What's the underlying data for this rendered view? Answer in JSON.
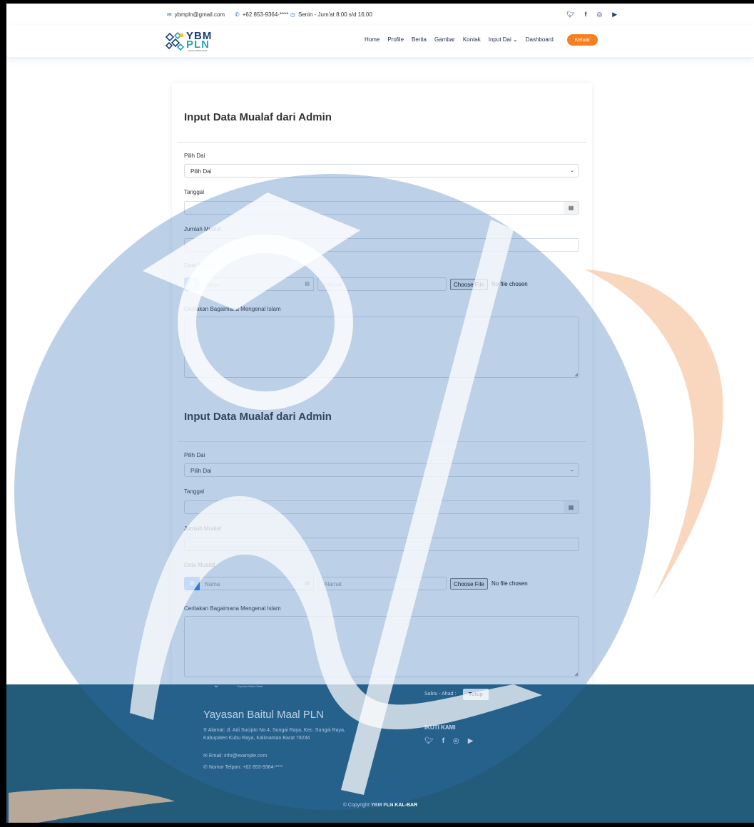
{
  "topbar": {
    "email": "ybmpln@gmail.com",
    "phone": "+62 853-9364-****",
    "hours": "Senin - Jum'at 8:00 s/d 16:00",
    "social_icons": [
      "twitter-icon",
      "facebook-icon",
      "instagram-icon",
      "youtube-icon"
    ]
  },
  "header": {
    "logo_line1": "YBM",
    "logo_line2": "PLN",
    "logo_sub": "Yayasan Baitul Maal",
    "nav": [
      "Home",
      "Profile",
      "Berita",
      "Gambar",
      "Kontak",
      "Input Dai",
      "Dashboard"
    ],
    "dropdown_chevron": "⌄",
    "logout": "Keluar",
    "accent": "#f5801f"
  },
  "forms": [
    {
      "title": "Input Data Mualaf dari Admin",
      "dai_label": "Pilih Dai",
      "dai_value": "Pilih Dai",
      "tanggal_label": "Tanggal",
      "jumlah_label": "Jumlah Mualaf",
      "data_label": "Data Mualaf",
      "nama_placeholder": "Nama",
      "alamat_placeholder": "Alamat",
      "file_button": "Choose File",
      "file_status": "No file chosen",
      "cerita_label": "Ceritakan Bagaimana Mengenal Islam"
    },
    {
      "title": "Input Data Mualaf dari Admin",
      "dai_label": "Pilih Dai",
      "dai_value": "Pilih Dai",
      "tanggal_label": "Tanggal",
      "jumlah_label": "Jumlah Mualaf",
      "data_label": "Data Mualaf",
      "nama_placeholder": "Nama",
      "alamat_placeholder": "Alamat",
      "file_button": "Choose File",
      "file_status": "No file chosen",
      "cerita_label": "Ceritakan Bagaimana Mengenal Islam"
    }
  ],
  "footer": {
    "logo_sub": "Yayasan Baitul Maal",
    "sabtu": "Sabtu - Ahad :",
    "tutup": "Tutup",
    "name": "Yayasan Baitul Maal PLN",
    "address_line1": "Alamat: Jl. Adi Sucipto No.4, Sungai Raya, Kec. Sungai Raya,",
    "address_line2": "Kabupaten Kubu Raya, Kalimantan Barat 78234",
    "email": "Email: info@example.com",
    "phone": "Nomor Telpon: +62 853-9364-****",
    "ikuti": "IKUTI KAMI",
    "copyright_prefix": "© Copyright",
    "copyright_bold": "YBM PLN KAL-BAR",
    "bg": "#235c7a"
  }
}
